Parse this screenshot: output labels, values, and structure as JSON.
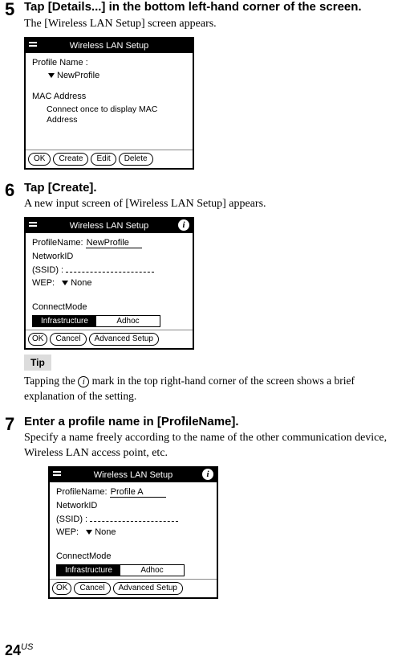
{
  "steps": {
    "s5": {
      "num": "5",
      "heading": "Tap [Details...] in the bottom left-hand corner of the screen.",
      "body": "The [Wireless LAN Setup] screen appears."
    },
    "s6": {
      "num": "6",
      "heading": "Tap [Create].",
      "body": "A new input screen of [Wireless LAN Setup] appears."
    },
    "s7": {
      "num": "7",
      "heading": "Enter a profile name in [ProfileName].",
      "body": "Specify a name freely according to the name of the other communication device, Wireless LAN access point, etc."
    }
  },
  "tip": {
    "label": "Tip",
    "text_pre": "Tapping the ",
    "text_post": " mark in the top right-hand corner of the screen shows a brief explanation of the setting."
  },
  "devA": {
    "title": "Wireless LAN Setup",
    "profile_label": "Profile Name :",
    "profile_value": "NewProfile",
    "mac_label": "MAC Address",
    "mac_msg": "Connect once to display MAC Address",
    "btn_ok": "OK",
    "btn_create": "Create",
    "btn_edit": "Edit",
    "btn_delete": "Delete"
  },
  "devB": {
    "title": "Wireless LAN Setup",
    "profile_label": "ProfileName:",
    "profile_value": "NewProfile",
    "network_label": "NetworkID",
    "ssid_label": "(SSID) :",
    "wep_label": "WEP:",
    "wep_value": "None",
    "connect_label": "ConnectMode",
    "mode_infra": "Infrastructure",
    "mode_adhoc": "Adhoc",
    "btn_ok": "OK",
    "btn_cancel": "Cancel",
    "btn_adv": "Advanced Setup"
  },
  "devC": {
    "title": "Wireless LAN Setup",
    "profile_label": "ProfileName:",
    "profile_value": "Profile A",
    "network_label": "NetworkID",
    "ssid_label": "(SSID) :",
    "wep_label": "WEP:",
    "wep_value": "None",
    "connect_label": "ConnectMode",
    "mode_infra": "Infrastructure",
    "mode_adhoc": "Adhoc",
    "btn_ok": "OK",
    "btn_cancel": "Cancel",
    "btn_adv": "Advanced Setup"
  },
  "footer": {
    "page": "24",
    "suffix": "US"
  }
}
